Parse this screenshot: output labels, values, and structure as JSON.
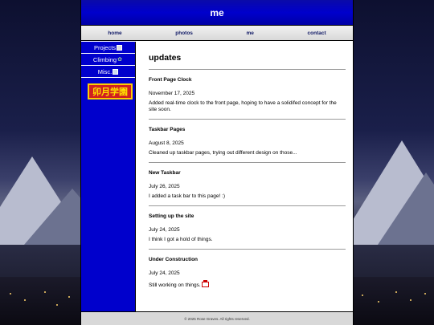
{
  "header": {
    "title": "me"
  },
  "topnav": [
    {
      "label": "home"
    },
    {
      "label": "photos"
    },
    {
      "label": "me"
    },
    {
      "label": "contact"
    }
  ],
  "sidebar": {
    "items": [
      {
        "label": "Projects",
        "icon": "folder-icon"
      },
      {
        "label": "Climbing",
        "icon": "plant-icon"
      },
      {
        "label": "Misc.",
        "icon": "folder-icon"
      }
    ],
    "badge": {
      "text": "卯月学園"
    }
  },
  "main": {
    "title": "updates",
    "posts": [
      {
        "title": "Front Page Clock",
        "date": "November 17, 2025",
        "text": "Added real-time clock to the front page, hoping to have a solidifed concept for the site soon."
      },
      {
        "title": "Taskbar Pages",
        "date": "August 8, 2025",
        "text": "Cleaned up taskbar pages, trying out different design on those..."
      },
      {
        "title": "New Taskbar",
        "date": "July 26, 2025",
        "text": "I added a task bar to this page! :)"
      },
      {
        "title": "Setting up the site",
        "date": "July 24, 2025",
        "text": "I think I got a hold of things."
      },
      {
        "title": "Under Construction",
        "date": "July 24, 2025",
        "text": "Still working on things."
      }
    ]
  },
  "footer": {
    "text": "© 2025 Rose Graves. All rights reserved."
  }
}
